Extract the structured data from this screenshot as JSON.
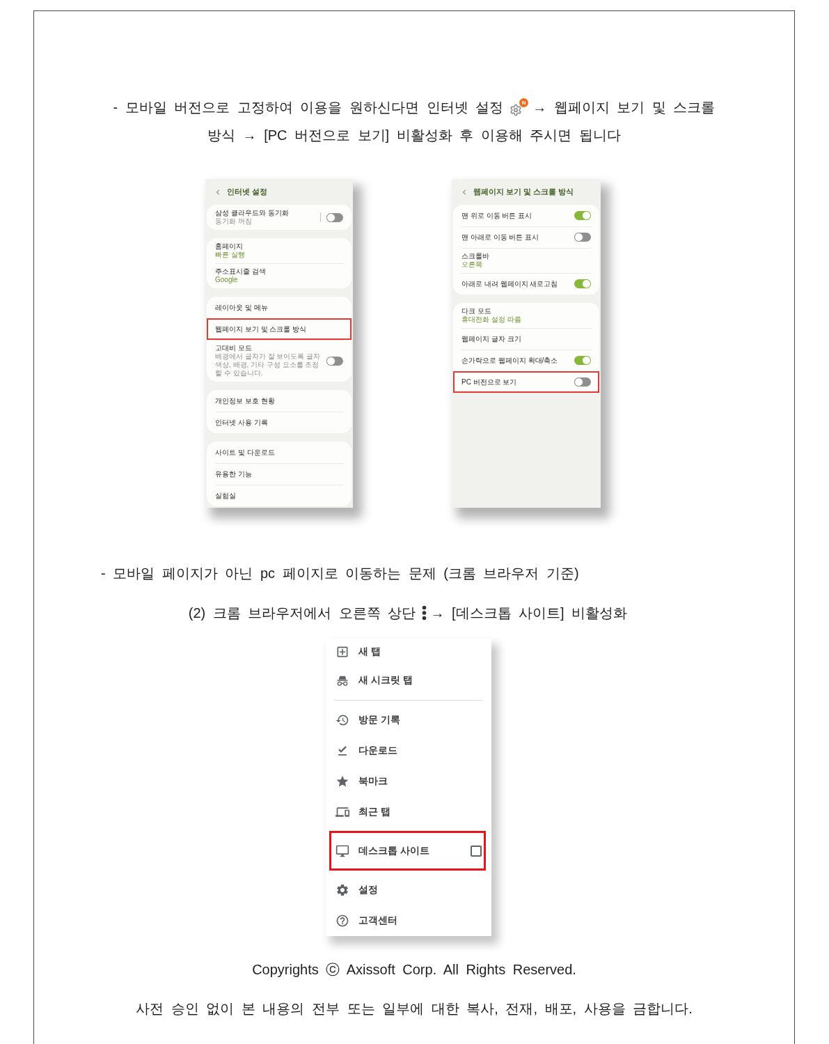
{
  "instruction_1": {
    "text_before_icon": "- 모바일 버전으로 고정하여 이용을 원하신다면 인터넷 설정",
    "icon_badge": "N",
    "text_after_icon": "→ 웹페이지 보기 및 스크롤",
    "line_2": "방식 → [PC 버전으로 보기] 비활성화 후 이용해 주시면 됩니다"
  },
  "screenshots": [
    {
      "title": "인터넷 설정",
      "groups": [
        {
          "items": [
            {
              "kind": "toggle",
              "label": "삼성 클라우드와 동기화",
              "description": "동기화 꺼짐",
              "on": false,
              "separator": true,
              "highlighted": false
            }
          ]
        },
        {
          "items": [
            {
              "kind": "link",
              "label": "홈페이지",
              "value": "빠른 실행",
              "highlighted": false
            },
            {
              "kind": "link",
              "label": "주소표시줄 검색",
              "value": "Google",
              "highlighted": false
            }
          ]
        },
        {
          "items": [
            {
              "kind": "link",
              "label": "레이아웃 및 메뉴",
              "highlighted": false
            },
            {
              "kind": "link",
              "label": "웹페이지 보기 및 스크롤 방식",
              "highlighted": true
            },
            {
              "kind": "toggle",
              "label": "고대비 모드",
              "description": "배경에서 글자가 잘 보이도록 글자 색상, 배경, 기타 구성 요소를 조정할 수 있습니다.",
              "on": false,
              "separator": false,
              "highlighted": false
            }
          ]
        },
        {
          "items": [
            {
              "kind": "link",
              "label": "개인정보 보호 현황",
              "highlighted": false
            },
            {
              "kind": "link",
              "label": "인터넷 사용 기록",
              "highlighted": false
            }
          ]
        },
        {
          "items": [
            {
              "kind": "link",
              "label": "사이트 및 다운로드",
              "highlighted": false
            },
            {
              "kind": "link",
              "label": "유용한 기능",
              "highlighted": false
            },
            {
              "kind": "link",
              "label": "실험실",
              "highlighted": false
            }
          ]
        }
      ]
    },
    {
      "title": "웹페이지 보기 및 스크롤 방식",
      "groups": [
        {
          "items": [
            {
              "kind": "toggle",
              "label": "맨 위로 이동 버튼 표시",
              "on": true,
              "separator": false,
              "highlighted": false
            },
            {
              "kind": "toggle",
              "label": "맨 아래로 이동 버튼 표시",
              "on": false,
              "separator": false,
              "highlighted": false
            },
            {
              "kind": "link",
              "label": "스크롤바",
              "value": "오른쪽",
              "highlighted": false
            },
            {
              "kind": "toggle",
              "label": "아래로 내려 웹페이지 새로고침",
              "on": true,
              "separator": false,
              "highlighted": false
            }
          ]
        },
        {
          "items": [
            {
              "kind": "link",
              "label": "다크 모드",
              "value": "휴대전화 설정 따름",
              "highlighted": false
            },
            {
              "kind": "link",
              "label": "웹페이지 글자 크기",
              "highlighted": false
            },
            {
              "kind": "toggle",
              "label": "손가락으로 웹페이지 확대/축소",
              "on": true,
              "separator": false,
              "highlighted": false
            },
            {
              "kind": "toggle",
              "label": "PC 버전으로 보기",
              "on": false,
              "separator": false,
              "highlighted": true
            }
          ]
        }
      ]
    }
  ],
  "instruction_2": "- 모바일 페이지가 아닌 pc 페이지로 이동하는 문제 (크롬 브라우저 기준)",
  "instruction_3": {
    "text_before_icon": "(2) 크롬 브라우저에서 오른쪽 상단",
    "text_after_icon": "→ [데스크톱 사이트] 비활성화"
  },
  "browser_menu": {
    "groups": [
      {
        "items": [
          {
            "kind": "item",
            "label": "새 탭",
            "highlighted": false
          },
          {
            "kind": "item",
            "label": "새 시크릿 탭",
            "highlighted": false
          }
        ]
      },
      {
        "items": [
          {
            "kind": "item",
            "label": "방문 기록",
            "highlighted": false
          },
          {
            "kind": "item",
            "label": "다운로드",
            "highlighted": false
          },
          {
            "kind": "item",
            "label": "북마크",
            "highlighted": false
          },
          {
            "kind": "item",
            "label": "최근 탭",
            "highlighted": false
          },
          {
            "kind": "checkbox",
            "label": "데스크톱 사이트",
            "checked": false,
            "highlighted": true
          },
          {
            "kind": "item",
            "label": "설정",
            "highlighted": false
          },
          {
            "kind": "item",
            "label": "고객센터",
            "highlighted": false
          }
        ]
      }
    ]
  },
  "footer": {
    "copyright": "Copyrights ⓒ Axissoft Corp. All Rights Reserved.",
    "notice": "사전 승인 없이 본 내용의 전부 또는 일부에 대한 복사, 전재, 배포, 사용을 금합니다."
  }
}
